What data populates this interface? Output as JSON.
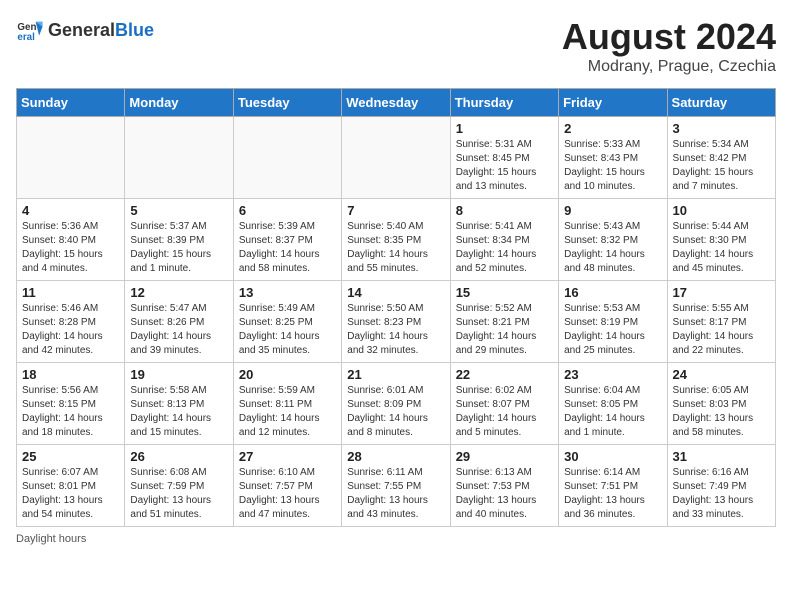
{
  "header": {
    "logo_general": "General",
    "logo_blue": "Blue",
    "month": "August 2024",
    "location": "Modrany, Prague, Czechia"
  },
  "weekdays": [
    "Sunday",
    "Monday",
    "Tuesday",
    "Wednesday",
    "Thursday",
    "Friday",
    "Saturday"
  ],
  "weeks": [
    [
      {
        "day": "",
        "info": ""
      },
      {
        "day": "",
        "info": ""
      },
      {
        "day": "",
        "info": ""
      },
      {
        "day": "",
        "info": ""
      },
      {
        "day": "1",
        "info": "Sunrise: 5:31 AM\nSunset: 8:45 PM\nDaylight: 15 hours\nand 13 minutes."
      },
      {
        "day": "2",
        "info": "Sunrise: 5:33 AM\nSunset: 8:43 PM\nDaylight: 15 hours\nand 10 minutes."
      },
      {
        "day": "3",
        "info": "Sunrise: 5:34 AM\nSunset: 8:42 PM\nDaylight: 15 hours\nand 7 minutes."
      }
    ],
    [
      {
        "day": "4",
        "info": "Sunrise: 5:36 AM\nSunset: 8:40 PM\nDaylight: 15 hours\nand 4 minutes."
      },
      {
        "day": "5",
        "info": "Sunrise: 5:37 AM\nSunset: 8:39 PM\nDaylight: 15 hours\nand 1 minute."
      },
      {
        "day": "6",
        "info": "Sunrise: 5:39 AM\nSunset: 8:37 PM\nDaylight: 14 hours\nand 58 minutes."
      },
      {
        "day": "7",
        "info": "Sunrise: 5:40 AM\nSunset: 8:35 PM\nDaylight: 14 hours\nand 55 minutes."
      },
      {
        "day": "8",
        "info": "Sunrise: 5:41 AM\nSunset: 8:34 PM\nDaylight: 14 hours\nand 52 minutes."
      },
      {
        "day": "9",
        "info": "Sunrise: 5:43 AM\nSunset: 8:32 PM\nDaylight: 14 hours\nand 48 minutes."
      },
      {
        "day": "10",
        "info": "Sunrise: 5:44 AM\nSunset: 8:30 PM\nDaylight: 14 hours\nand 45 minutes."
      }
    ],
    [
      {
        "day": "11",
        "info": "Sunrise: 5:46 AM\nSunset: 8:28 PM\nDaylight: 14 hours\nand 42 minutes."
      },
      {
        "day": "12",
        "info": "Sunrise: 5:47 AM\nSunset: 8:26 PM\nDaylight: 14 hours\nand 39 minutes."
      },
      {
        "day": "13",
        "info": "Sunrise: 5:49 AM\nSunset: 8:25 PM\nDaylight: 14 hours\nand 35 minutes."
      },
      {
        "day": "14",
        "info": "Sunrise: 5:50 AM\nSunset: 8:23 PM\nDaylight: 14 hours\nand 32 minutes."
      },
      {
        "day": "15",
        "info": "Sunrise: 5:52 AM\nSunset: 8:21 PM\nDaylight: 14 hours\nand 29 minutes."
      },
      {
        "day": "16",
        "info": "Sunrise: 5:53 AM\nSunset: 8:19 PM\nDaylight: 14 hours\nand 25 minutes."
      },
      {
        "day": "17",
        "info": "Sunrise: 5:55 AM\nSunset: 8:17 PM\nDaylight: 14 hours\nand 22 minutes."
      }
    ],
    [
      {
        "day": "18",
        "info": "Sunrise: 5:56 AM\nSunset: 8:15 PM\nDaylight: 14 hours\nand 18 minutes."
      },
      {
        "day": "19",
        "info": "Sunrise: 5:58 AM\nSunset: 8:13 PM\nDaylight: 14 hours\nand 15 minutes."
      },
      {
        "day": "20",
        "info": "Sunrise: 5:59 AM\nSunset: 8:11 PM\nDaylight: 14 hours\nand 12 minutes."
      },
      {
        "day": "21",
        "info": "Sunrise: 6:01 AM\nSunset: 8:09 PM\nDaylight: 14 hours\nand 8 minutes."
      },
      {
        "day": "22",
        "info": "Sunrise: 6:02 AM\nSunset: 8:07 PM\nDaylight: 14 hours\nand 5 minutes."
      },
      {
        "day": "23",
        "info": "Sunrise: 6:04 AM\nSunset: 8:05 PM\nDaylight: 14 hours\nand 1 minute."
      },
      {
        "day": "24",
        "info": "Sunrise: 6:05 AM\nSunset: 8:03 PM\nDaylight: 13 hours\nand 58 minutes."
      }
    ],
    [
      {
        "day": "25",
        "info": "Sunrise: 6:07 AM\nSunset: 8:01 PM\nDaylight: 13 hours\nand 54 minutes."
      },
      {
        "day": "26",
        "info": "Sunrise: 6:08 AM\nSunset: 7:59 PM\nDaylight: 13 hours\nand 51 minutes."
      },
      {
        "day": "27",
        "info": "Sunrise: 6:10 AM\nSunset: 7:57 PM\nDaylight: 13 hours\nand 47 minutes."
      },
      {
        "day": "28",
        "info": "Sunrise: 6:11 AM\nSunset: 7:55 PM\nDaylight: 13 hours\nand 43 minutes."
      },
      {
        "day": "29",
        "info": "Sunrise: 6:13 AM\nSunset: 7:53 PM\nDaylight: 13 hours\nand 40 minutes."
      },
      {
        "day": "30",
        "info": "Sunrise: 6:14 AM\nSunset: 7:51 PM\nDaylight: 13 hours\nand 36 minutes."
      },
      {
        "day": "31",
        "info": "Sunrise: 6:16 AM\nSunset: 7:49 PM\nDaylight: 13 hours\nand 33 minutes."
      }
    ]
  ],
  "footer": "Daylight hours"
}
